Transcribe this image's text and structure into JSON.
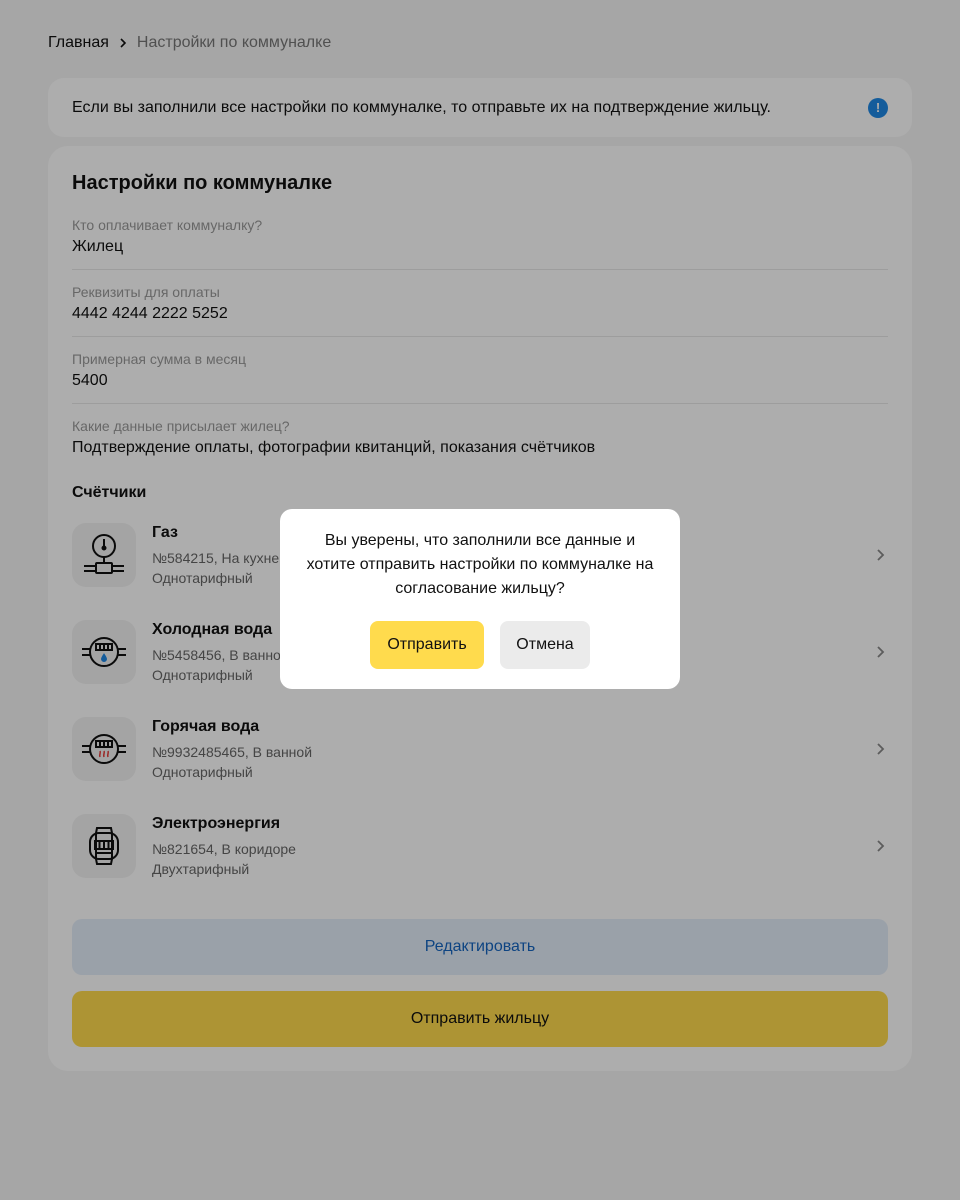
{
  "breadcrumb": {
    "home": "Главная",
    "current": "Настройки по коммуналке"
  },
  "banner": {
    "text": "Если вы заполнили все настройки по коммуналке, то отправьте их на подтверждение жильцу.",
    "icon": "exclamation-icon"
  },
  "card": {
    "title": "Настройки по коммуналке",
    "fields": [
      {
        "label": "Кто оплачивает коммуналку?",
        "value": "Жилец"
      },
      {
        "label": "Реквизиты для оплаты",
        "value": "4442 4244 2222 5252"
      },
      {
        "label": "Примерная сумма в месяц",
        "value": "5400"
      },
      {
        "label": "Какие данные присылает жилец?",
        "value": "Подтверждение оплаты, фотографии квитанций, показания счётчиков"
      }
    ],
    "meters_title": "Счётчики",
    "meters": [
      {
        "name": "Газ",
        "details": "№584215, На кухне",
        "tariff": "Однотарифный",
        "icon": "gas-meter-icon"
      },
      {
        "name": "Холодная вода",
        "details": "№5458456, В ванной",
        "tariff": "Однотарифный",
        "icon": "cold-water-meter-icon"
      },
      {
        "name": "Горячая вода",
        "details": "№9932485465, В ванной",
        "tariff": "Однотарифный",
        "icon": "hot-water-meter-icon"
      },
      {
        "name": "Электроэнергия",
        "details": "№821654, В коридоре",
        "tariff": "Двухтарифный",
        "icon": "electricity-meter-icon"
      }
    ],
    "edit_label": "Редактировать",
    "send_tenant_label": "Отправить жильцу"
  },
  "dialog": {
    "text": "Вы уверены, что заполнили все данные и хотите отправить настройки по коммуналке на согласование жильцу?",
    "send_label": "Отправить",
    "cancel_label": "Отмена"
  },
  "colors": {
    "accent": "#ffdb4d",
    "link": "#1565c0",
    "info": "#1e88e5"
  }
}
